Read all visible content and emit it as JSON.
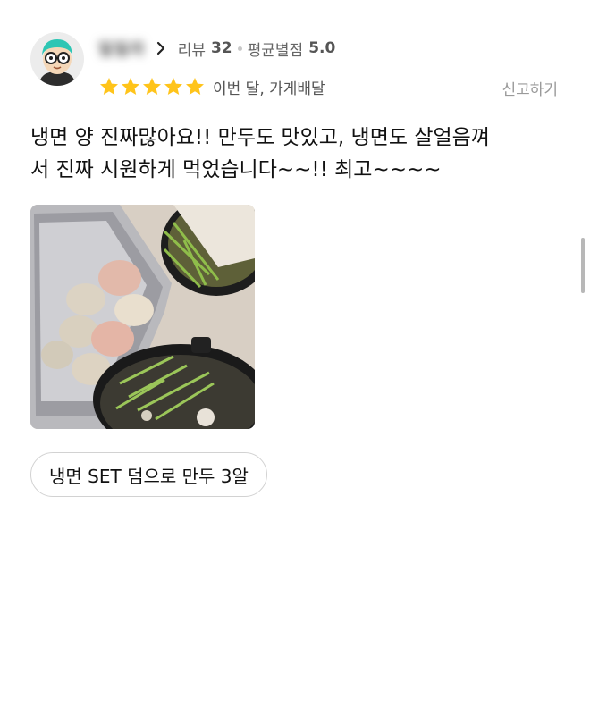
{
  "review": {
    "nickname": "밀밀라",
    "review_count_label": "리뷰",
    "review_count": "32",
    "avg_rating_label": "평균별점",
    "avg_rating": "5.0",
    "star_count": 5,
    "star_color": "#ffc41a",
    "meta": "이번 달, 가게배달",
    "report_label": "신고하기",
    "content_line1": "냉면 양 진짜많아요!! 만두도 맛있고, 냉면도 살얼음껴",
    "content_line2": "서 진짜 시원하게 먹었습니다~~!! 최고~~~~",
    "menu_tag": "냉면 SET 덤으로 만두 3알"
  }
}
